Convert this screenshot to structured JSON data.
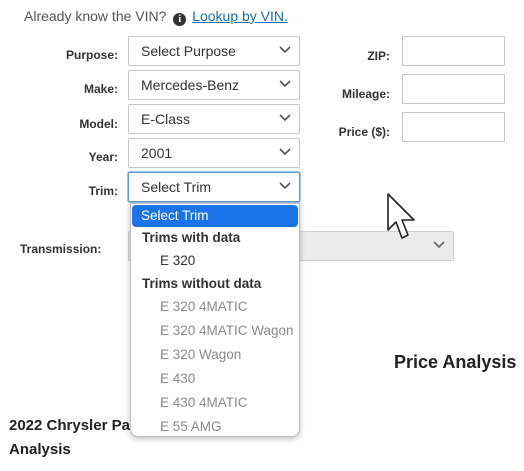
{
  "vin": {
    "prompt": "Already know the VIN?",
    "info_icon": "info-circle-icon",
    "link": "Lookup by VIN."
  },
  "labels": {
    "purpose": "Purpose:",
    "make": "Make:",
    "model": "Model:",
    "year": "Year:",
    "trim": "Trim:",
    "transmission": "Transmission:",
    "zip": "ZIP:",
    "mileage": "Mileage:",
    "price": "Price ($):"
  },
  "selects": {
    "purpose": "Select Purpose",
    "make": "Mercedes-Benz",
    "model": "E-Class",
    "year": "2001",
    "trim": "Select Trim"
  },
  "inputs": {
    "zip": "",
    "mileage": "",
    "price": ""
  },
  "dropdown": {
    "selected": "Select Trim",
    "group1": "Trims with data",
    "with_data": [
      "E 320"
    ],
    "group2": "Trims without data",
    "without_data": [
      "E 320 4MATIC",
      "E 320 4MATIC Wagon",
      "E 320 Wagon",
      "E 430",
      "E 430 4MATIC",
      "E 55 AMG"
    ]
  },
  "headings": {
    "price_analysis": "Price Analysis",
    "chrysler_line1": "2022 Chrysler Pa",
    "chrysler_line2": "Analysis"
  },
  "cursor_icon": "mouse-pointer-icon"
}
